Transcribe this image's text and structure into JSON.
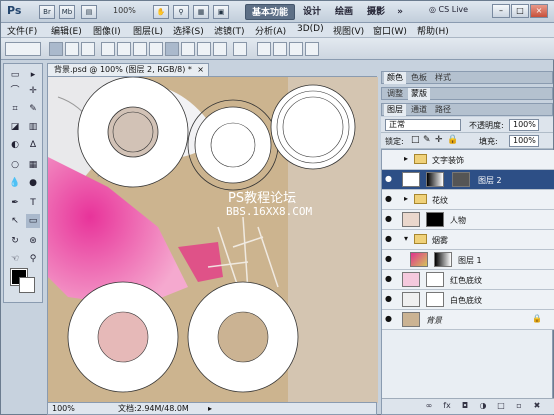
{
  "titlebar": {
    "app_logo": "Ps",
    "icons": [
      "Br",
      "Mb"
    ],
    "zoom_value": "100%",
    "workspaces": [
      "基本功能",
      "设计",
      "绘画",
      "摄影"
    ],
    "more": "»",
    "cslive": "CS Live",
    "window_controls": [
      "–",
      "□",
      "×"
    ]
  },
  "menubar": {
    "items": [
      "文件(F)",
      "编辑(E)",
      "图像(I)",
      "图层(L)",
      "选择(S)",
      "滤镜(T)",
      "分析(A)",
      "3D(D)",
      "视图(V)",
      "窗口(W)",
      "帮助(H)"
    ]
  },
  "document": {
    "tab_title": "背景.psd @ 100% (图层 2, RGB/8) *",
    "tab_close": "×",
    "watermark_text": "PS教程论坛",
    "watermark_url": "BBS.16XX8.COM",
    "status_zoom": "100%",
    "status_info": "文档:2.94M/48.0M"
  },
  "panels": {
    "group1_tabs": [
      "颜色",
      "色板",
      "样式"
    ],
    "group2_tabs": [
      "调整",
      "蒙版"
    ],
    "layers_tabs": [
      "图层",
      "通道",
      "路径"
    ],
    "blend_mode": "正常",
    "opacity_label": "不透明度:",
    "opacity_value": "100%",
    "lock_label": "锁定:",
    "fill_label": "填充:",
    "fill_value": "100%",
    "layers": [
      {
        "name": "文字装饰",
        "kind": "group",
        "eye": false
      },
      {
        "name": "图层 2",
        "kind": "layer-mask",
        "eye": true,
        "active": true
      },
      {
        "name": "花纹",
        "kind": "group",
        "eye": true
      },
      {
        "name": "人物",
        "kind": "layer-mask",
        "eye": true
      },
      {
        "name": "烟雾",
        "kind": "group",
        "eye": true
      },
      {
        "name": "图层 1",
        "kind": "layer-mask",
        "eye": true
      },
      {
        "name": "红色底纹",
        "kind": "layer-mask",
        "eye": true
      },
      {
        "name": "白色底纹",
        "kind": "layer-mask",
        "eye": true
      },
      {
        "name": "背景",
        "kind": "background",
        "eye": true
      }
    ],
    "bottom_icons": [
      "link-icon",
      "fx-icon",
      "mask-icon",
      "adjustment-icon",
      "folder-icon",
      "new-layer-icon",
      "trash-icon"
    ],
    "bottom_glyphs": [
      "∞",
      "fx",
      "◘",
      "◑",
      "□",
      "▫",
      "✖"
    ]
  },
  "tools": {
    "glyphs": [
      "▭",
      "▸",
      "⌒",
      "✛",
      "⌗",
      "✎",
      "◪",
      "▥",
      "◐",
      "∆",
      "○",
      "T",
      "↖",
      "▭",
      "☜",
      "⚲"
    ]
  },
  "colors": {
    "accent": "#2d4f86",
    "canvas_bg": "#c9b18e",
    "pink": "#e0338e"
  }
}
